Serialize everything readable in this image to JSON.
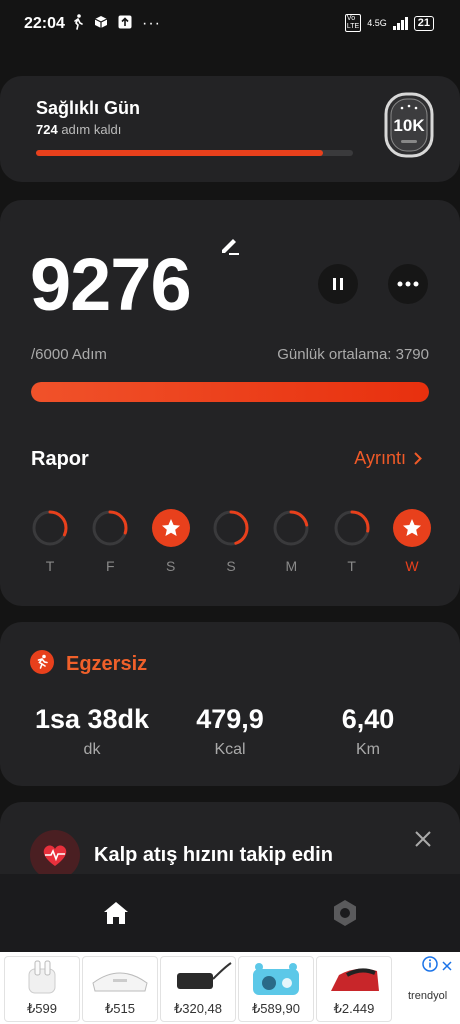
{
  "status_bar": {
    "time": "22:04",
    "network": "4.5G",
    "battery": "21"
  },
  "goal_card": {
    "title": "Sağlıklı Gün",
    "steps_left_value": "724",
    "steps_left_text": "adım kaldı",
    "progress": 0.905,
    "badge": "10K"
  },
  "steps_card": {
    "steps": "9276",
    "goal": "/6000 Adım",
    "daily_average": "Günlük ortalama: 3790",
    "progress": 1.0,
    "report_title": "Rapor",
    "details_link": "Ayrıntı",
    "days": [
      {
        "label": "T",
        "completed": false,
        "progress": 0.32
      },
      {
        "label": "F",
        "completed": false,
        "progress": 0.3
      },
      {
        "label": "S",
        "completed": true,
        "progress": 1.0
      },
      {
        "label": "S",
        "completed": false,
        "progress": 0.45
      },
      {
        "label": "M",
        "completed": false,
        "progress": 0.22
      },
      {
        "label": "T",
        "completed": false,
        "progress": 0.28
      },
      {
        "label": "W",
        "completed": true,
        "progress": 1.0
      }
    ]
  },
  "exercise_card": {
    "title": "Egzersiz",
    "duration": "1sa 38dk",
    "duration_unit": "dk",
    "calories": "479,9",
    "calories_unit": "Kcal",
    "distance": "6,40",
    "distance_unit": "Km"
  },
  "heart_card": {
    "title": "Kalp atış hızını takip edin"
  },
  "ad": {
    "prices": [
      "₺599",
      "₺515",
      "₺320,48",
      "₺589,90",
      "₺2.449"
    ],
    "brand": "trendyol"
  },
  "colors": {
    "accent": "#e8401c",
    "card": "#232325",
    "background": "#141414"
  }
}
